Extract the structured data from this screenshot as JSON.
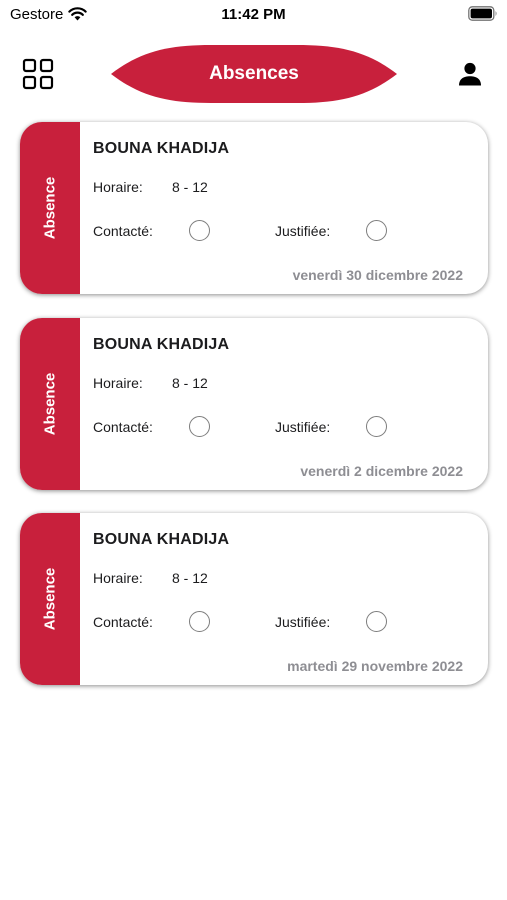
{
  "status_bar": {
    "carrier": "Gestore",
    "time": "11:42 PM",
    "wifi_icon": "wifi-icon",
    "battery_icon": "battery-icon"
  },
  "header": {
    "title": "Absences",
    "menu_icon": "grid-icon",
    "profile_icon": "person-icon"
  },
  "colors": {
    "accent": "#c8203c",
    "date_text": "#8e8e93",
    "radio_border": "#7d7d7d"
  },
  "absences": [
    {
      "type": "Absence",
      "name": "BOUNA KHADIJA",
      "horaire_label": "Horaire:",
      "horaire": "8 - 12",
      "contacte_label": "Contacté:",
      "contacte": false,
      "justifiee_label": "Justifiée:",
      "justifiee": false,
      "date": "venerdì 30 dicembre 2022"
    },
    {
      "type": "Absence",
      "name": "BOUNA KHADIJA",
      "horaire_label": "Horaire:",
      "horaire": "8 - 12",
      "contacte_label": "Contacté:",
      "contacte": false,
      "justifiee_label": "Justifiée:",
      "justifiee": false,
      "date": "venerdì 2 dicembre 2022"
    },
    {
      "type": "Absence",
      "name": "BOUNA KHADIJA",
      "horaire_label": "Horaire:",
      "horaire": "8 - 12",
      "contacte_label": "Contacté:",
      "contacte": false,
      "justifiee_label": "Justifiée:",
      "justifiee": false,
      "date": "martedì 29 novembre 2022"
    }
  ]
}
